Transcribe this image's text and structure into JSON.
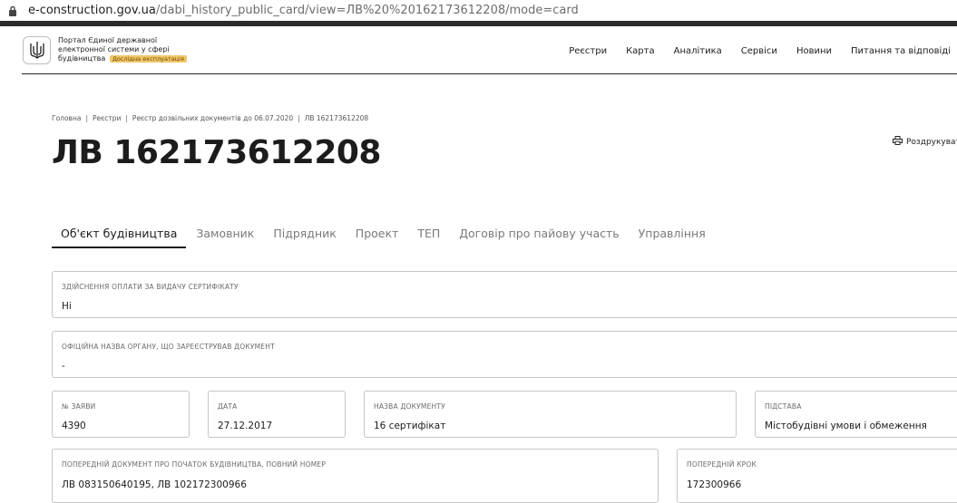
{
  "browser": {
    "url_domain": "e-construction.gov.ua",
    "url_path": "/dabi_history_public_card/view=ЛВ%20%20162173612208/mode=card"
  },
  "header": {
    "logo_text": "Портал Єдиної державної електронної системи у сфері будівництва",
    "beta_badge": "Дослідна експлуатація",
    "nav": [
      "Реєстри",
      "Карта",
      "Аналітика",
      "Сервіси",
      "Новини",
      "Питання та відповіді"
    ]
  },
  "breadcrumb": [
    "Головна",
    "Реєстри",
    "Реєстр дозвільних документів до 06.07.2020",
    "ЛВ 162173612208"
  ],
  "page_title": "ЛВ 162173612208",
  "print_label": "Роздрукувати",
  "tabs": [
    "Об'єкт будівництва",
    "Замовник",
    "Підрядник",
    "Проект",
    "ТЕП",
    "Договір про пайову участь",
    "Управління"
  ],
  "fields": {
    "payment": {
      "label": "Здійснення оплати за видачу сертифікату",
      "value": "Ні"
    },
    "authority": {
      "label": "Офіційна назва органу, що зареєстрував документ",
      "value": "-"
    },
    "application_no": {
      "label": "№ заяви",
      "value": "4390"
    },
    "date": {
      "label": "Дата",
      "value": "27.12.2017"
    },
    "doc_name": {
      "label": "Назва документу",
      "value": "16 сертифікат"
    },
    "basis": {
      "label": "Підстава",
      "value": "Містобудівні умови і обмеження"
    },
    "prev_doc": {
      "label": "Попередній документ про початок будівництва, повний номер",
      "value": "ЛВ 083150640195, ЛВ 102172300966"
    },
    "prev_step": {
      "label": "Попередній крок",
      "value": "172300966"
    }
  }
}
